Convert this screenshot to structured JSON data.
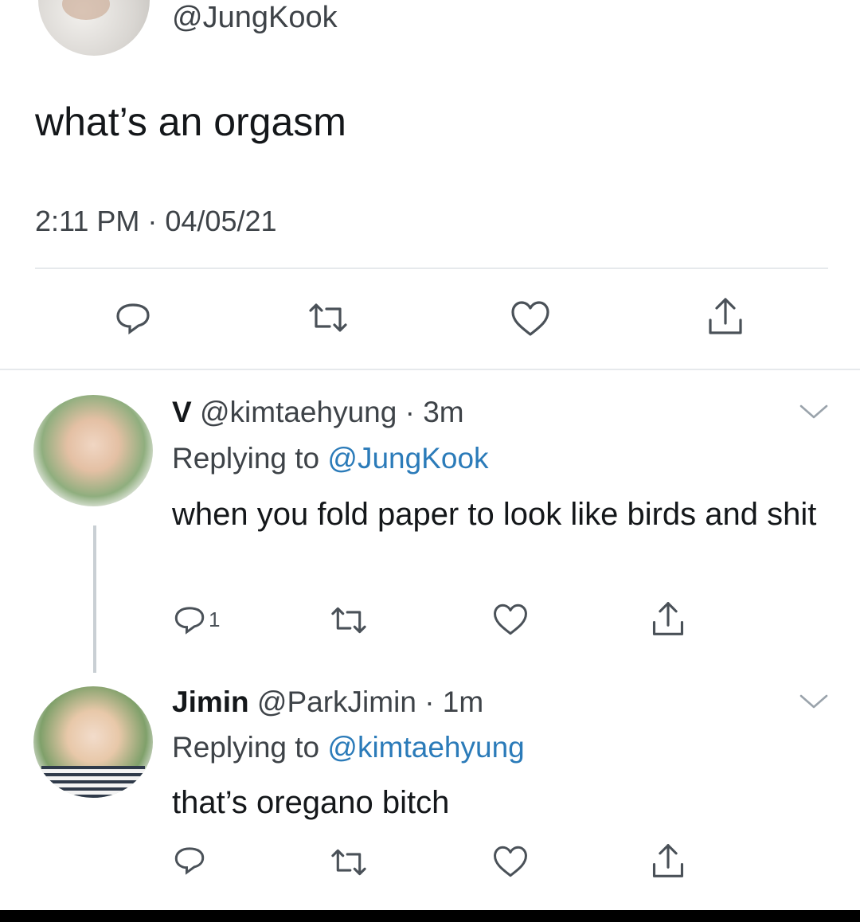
{
  "main_tweet": {
    "handle": "@JungKook",
    "text": "what’s an orgasm",
    "timestamp": "2:11 PM · 04/05/21",
    "actions": [
      "reply-icon",
      "retweet-icon",
      "like-icon",
      "share-icon"
    ]
  },
  "replies": [
    {
      "name": "V",
      "handle": "@kimtaehyung",
      "time": "· 3m",
      "replying_label": "Replying to",
      "replying_to": "@JungKook",
      "text": "when you fold paper to look like birds and shit",
      "reply_count": "1"
    },
    {
      "name": "Jimin",
      "handle": "@ParkJimin",
      "time": "· 1m",
      "replying_label": "Replying to",
      "replying_to": "@kimtaehyung",
      "text": "that’s oregano bitch",
      "reply_count": ""
    }
  ],
  "colors": {
    "text": "#14171a",
    "secondary": "#3e4348",
    "link": "#2b7bb9",
    "divider": "#e6e9ec"
  }
}
